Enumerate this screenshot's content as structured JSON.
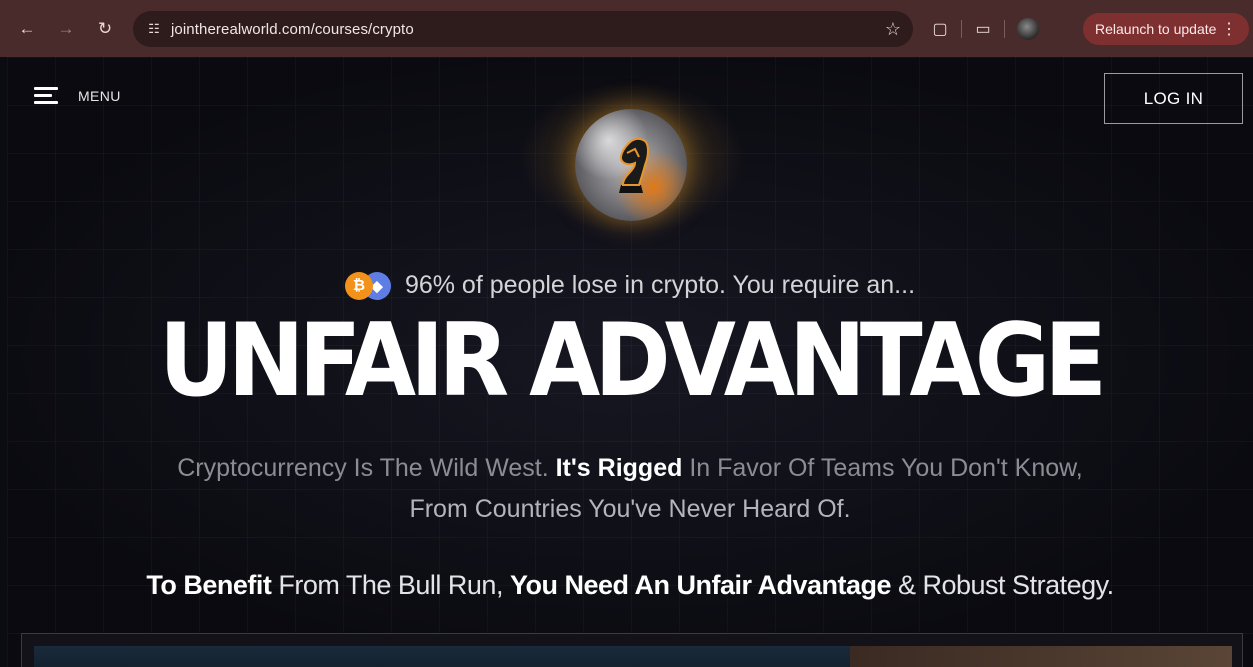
{
  "browser": {
    "url": "jointherealworld.com/courses/crypto",
    "relaunch_label": "Relaunch to update"
  },
  "nav": {
    "menu_label": "MENU",
    "login_label": "LOG IN"
  },
  "hero": {
    "subhead": "96% of people lose in crypto. You require an...",
    "headline": "UNFAIR ADVANTAGE",
    "desc_part1": "Cryptocurrency Is The Wild West. ",
    "desc_bold": "It's Rigged",
    "desc_part2": " In Favor Of Teams You Don't Know,",
    "desc_line2": "From Countries You've Never Heard Of.",
    "tag_bold1": "To Benefit",
    "tag_part1": " From The Bull Run, ",
    "tag_bold2": "You Need An Unfair Advantage",
    "tag_part2": " & Robust Strategy."
  },
  "icons": {
    "back": "arrow-left-icon",
    "forward": "arrow-right-icon",
    "reload": "reload-icon",
    "site_settings": "tune-icon",
    "bookmark": "star-icon",
    "extensions": "puzzle-icon",
    "reading": "reading-list-icon",
    "coin1": "bitcoin-icon",
    "coin2": "ethereum-icon"
  },
  "colors": {
    "chrome_bg": "#4a2b2b",
    "relaunch_bg": "#7e2f2f",
    "page_bg": "#0b0b12",
    "bitcoin": "#f2921b",
    "ethereum": "#5e7ee6"
  }
}
